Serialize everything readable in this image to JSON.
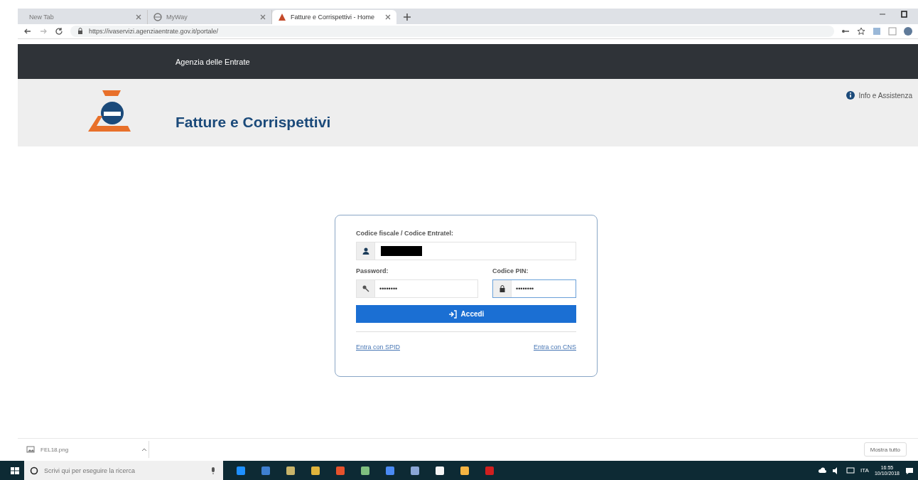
{
  "browser": {
    "tabs": [
      {
        "title": "New Tab",
        "selected": false
      },
      {
        "title": "MyWay",
        "selected": false
      },
      {
        "title": "Fatture e Corrispettivi - Home",
        "selected": true
      }
    ],
    "url": "https://ivaservizi.agenziaentrate.gov.it/portale/"
  },
  "site_bar": {
    "title": "Agenzia delle Entrate"
  },
  "header": {
    "title": "Fatture e Corrispettivi",
    "help_link": "Info e Assistenza"
  },
  "login": {
    "username_label": "Codice fiscale / Codice Entratel:",
    "username_redacted": true,
    "password_label": "Password:",
    "password_value": "••••••••",
    "pin_label": "Codice PIN:",
    "pin_value": "••••••••",
    "pin_focused": true,
    "submit": "Accedi",
    "links": [
      "Entra con SPID",
      "Entra con CNS"
    ]
  },
  "download_bar": {
    "file": "FEL18.png",
    "show_all": "Mostra tutto"
  },
  "taskbar": {
    "search_placeholder": "Scrivi qui per eseguire la ricerca",
    "language": "ITA",
    "time": "16:55",
    "date": "10/10/2018"
  }
}
